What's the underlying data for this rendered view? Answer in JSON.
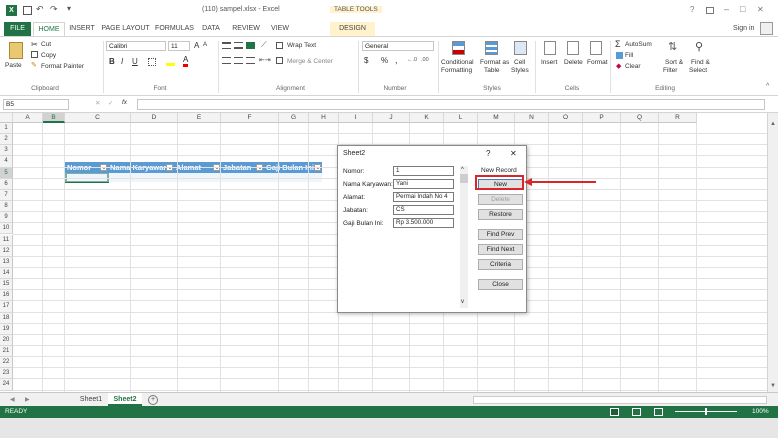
{
  "window": {
    "title": "(110) sampel.xlsx - Excel",
    "context_tab_group": "TABLE TOOLS",
    "help": "?",
    "minimize": "–",
    "restore": "□",
    "close": "✕",
    "signin": "Sign in"
  },
  "tabs": [
    "FILE",
    "HOME",
    "INSERT",
    "PAGE LAYOUT",
    "FORMULAS",
    "DATA",
    "REVIEW",
    "VIEW",
    "DESIGN"
  ],
  "ribbon": {
    "clipboard": {
      "paste": "Paste",
      "cut": "Cut",
      "copy": "Copy",
      "format_painter": "Format Painter",
      "label": "Clipboard"
    },
    "font": {
      "name": "Calibri",
      "size": "11",
      "bold": "B",
      "italic": "I",
      "underline": "U",
      "grow": "A",
      "shrink": "A",
      "label": "Font"
    },
    "alignment": {
      "wrap": "Wrap Text",
      "merge": "Merge & Center",
      "label": "Alignment"
    },
    "number": {
      "format": "General",
      "currency": "$",
      "percent": "%",
      "comma": ",",
      "label": "Number"
    },
    "styles": {
      "conditional": "Conditional",
      "conditional2": "Formatting",
      "format_as": "Format as",
      "table": "Table",
      "cell": "Cell",
      "cell_styles": "Styles",
      "label": "Styles"
    },
    "cells": {
      "insert": "Insert",
      "delete": "Delete",
      "format": "Format",
      "label": "Cells"
    },
    "editing": {
      "autosum": "AutoSum",
      "fill": "Fill",
      "clear": "Clear",
      "sort": "Sort &",
      "filter": "Filter",
      "find": "Find &",
      "select": "Select",
      "label": "Editing"
    }
  },
  "formula_bar": {
    "name_box": "B5",
    "fx": "fx",
    "cancel": "✕",
    "enter": "✓",
    "value": ""
  },
  "columns": [
    "A",
    "B",
    "C",
    "D",
    "E",
    "F",
    "G",
    "H",
    "I",
    "J",
    "K",
    "L",
    "M",
    "N",
    "O",
    "P",
    "Q",
    "R"
  ],
  "rows": [
    "1",
    "2",
    "3",
    "4",
    "5",
    "6",
    "7",
    "8",
    "9",
    "10",
    "11",
    "12",
    "13",
    "14",
    "15",
    "16",
    "17",
    "18",
    "19",
    "20",
    "21",
    "22",
    "23",
    "24"
  ],
  "table_headers": [
    "Nomor",
    "Nama Karyawan",
    "Alamat",
    "Jabatan",
    "Gaji Bulan Ini"
  ],
  "sheets": [
    "Sheet1",
    "Sheet2"
  ],
  "status": {
    "ready": "READY",
    "zoom": "100%"
  },
  "dialog": {
    "title": "Sheet2",
    "help": "?",
    "close": "✕",
    "record_label": "New Record",
    "fields": [
      {
        "label": "Nomor:",
        "value": "1"
      },
      {
        "label": "Nama Karyawan:",
        "value": "Yani"
      },
      {
        "label": "Alamat:",
        "value": "Permai Indah No 4"
      },
      {
        "label": "Jabatan:",
        "value": "CS"
      },
      {
        "label": "Gaji Bulan Ini:",
        "value": "Rp 3.500.000"
      }
    ],
    "buttons": [
      "New",
      "Delete",
      "Restore",
      "Find Prev",
      "Find Next",
      "Criteria",
      "Close"
    ]
  },
  "colors": {
    "excel_green": "#217346",
    "table_header": "#5b9bd5",
    "highlight": "#d9262b"
  }
}
